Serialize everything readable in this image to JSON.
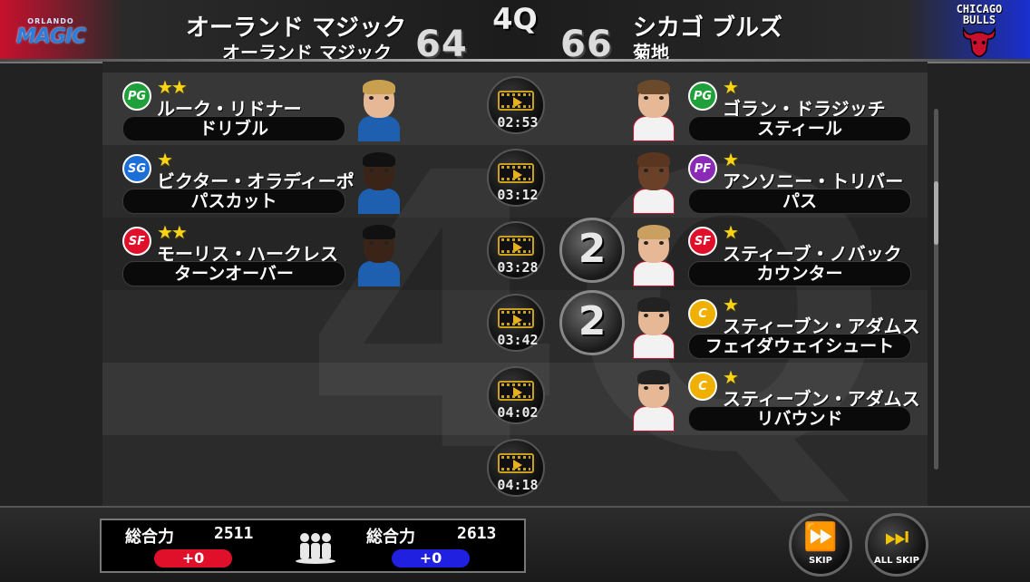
{
  "header": {
    "home_logo_small": "ORLANDO",
    "home_logo_big": "MAGIC",
    "away_logo_text": "CHICAGO BULLS",
    "home_team": "オーランド マジック",
    "home_coach": "オーランド マジック",
    "away_team": "シカゴ ブルズ",
    "away_coach": "菊地",
    "quarter": "4Q",
    "home_score": "64",
    "away_score": "66"
  },
  "feed": {
    "watermark": "4Q",
    "rows": [
      {
        "time": "02:53",
        "left": {
          "pos": "PG",
          "pos_color": "#1fa03a",
          "stars": "★★",
          "name": "ルーク・リドナー",
          "action": "ドリブル"
        },
        "right": {
          "pos": "PG",
          "pos_color": "#1fa03a",
          "stars": "★",
          "name": "ゴラン・ドラジッチ",
          "action": "スティール"
        }
      },
      {
        "time": "03:12",
        "left": {
          "pos": "SG",
          "pos_color": "#1d6fd8",
          "stars": "★",
          "name": "ビクター・オラディーポ",
          "action": "パスカット"
        },
        "right": {
          "pos": "PF",
          "pos_color": "#8a2ab5",
          "stars": "★",
          "name": "アンソニー・トリバー",
          "action": "パス"
        }
      },
      {
        "time": "03:28",
        "combo": "2",
        "left": {
          "pos": "SF",
          "pos_color": "#e0102a",
          "stars": "★★",
          "name": "モーリス・ハークレス",
          "action": "ターンオーバー"
        },
        "right": {
          "pos": "SF",
          "pos_color": "#e0102a",
          "stars": "★",
          "name": "スティーブ・ノバック",
          "action": "カウンター"
        }
      },
      {
        "time": "03:42",
        "combo": "2",
        "right": {
          "pos": "C",
          "pos_color": "#f0b000",
          "stars": "★",
          "name": "スティーブン・アダムス",
          "action": "フェイダウェイシュート"
        }
      },
      {
        "time": "04:02",
        "right": {
          "pos": "C",
          "pos_color": "#f0b000",
          "stars": "★",
          "name": "スティーブン・アダムス",
          "action": "リバウンド"
        }
      },
      {
        "time": "04:18"
      }
    ]
  },
  "footer": {
    "home_power_label": "総合力",
    "home_power_value": "2511",
    "home_bonus": "+0",
    "away_power_label": "総合力",
    "away_power_value": "2613",
    "away_bonus": "+0",
    "skip_label": "SKIP",
    "all_skip_label": "ALL SKIP"
  },
  "colors": {
    "home": "#c8102e",
    "away": "#1a2fd0",
    "star": "#f7d41c"
  }
}
